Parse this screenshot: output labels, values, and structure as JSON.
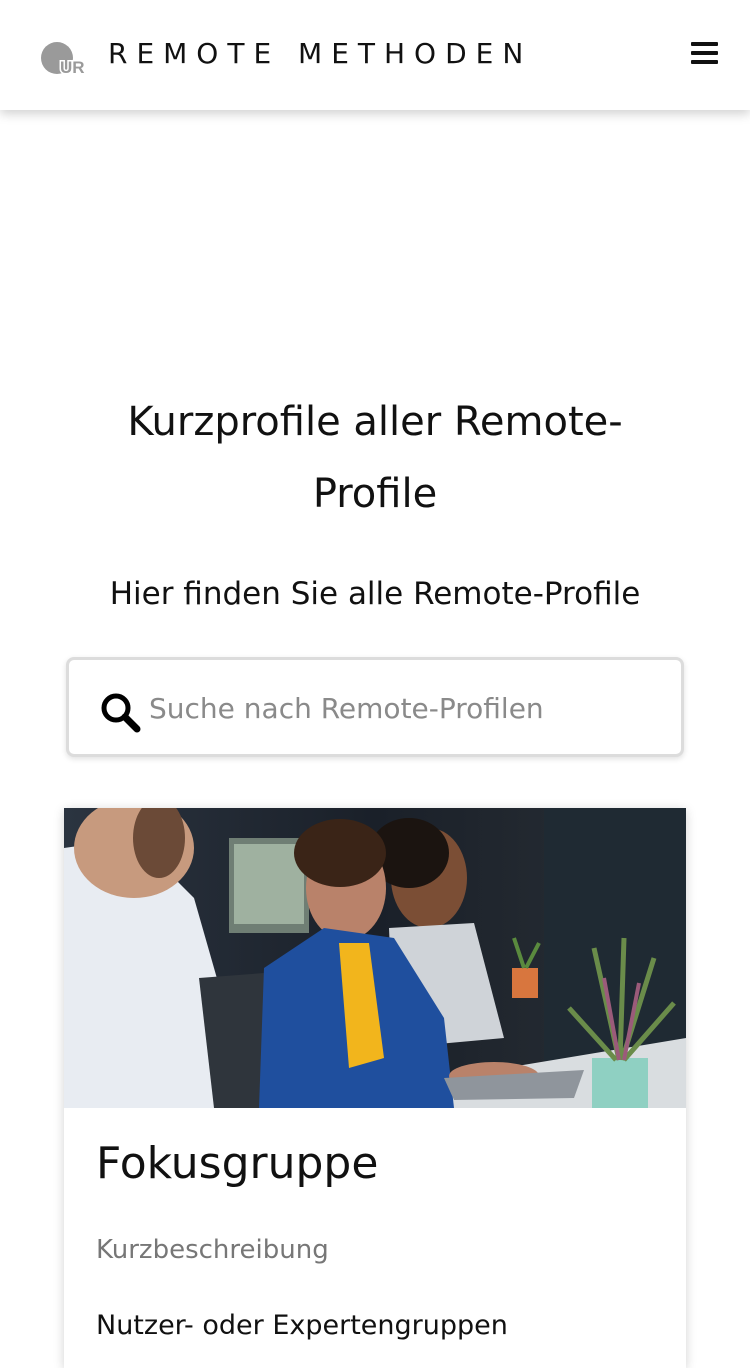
{
  "header": {
    "brand": "REMOTE METHODEN",
    "logo_text": "UR",
    "menu_icon": "hamburger-menu-icon"
  },
  "main": {
    "title": "Kurzprofile aller Remote-Profile",
    "subtitle": "Hier finden Sie alle Remote-Profile",
    "search": {
      "placeholder": "Suche nach Remote-Profilen",
      "value": "",
      "icon": "search-icon"
    }
  },
  "cards": [
    {
      "title": "Fokusgruppe",
      "label": "Kurzbeschreibung",
      "text": "Nutzer- oder Expertengruppen"
    }
  ],
  "colors": {
    "text": "#111111",
    "muted": "#777777",
    "placeholder": "#8a8a8a",
    "logo_gray": "#9a9a9a",
    "blazer_blue": "#1f4f9e",
    "shirt_yellow": "#f2b51c"
  }
}
